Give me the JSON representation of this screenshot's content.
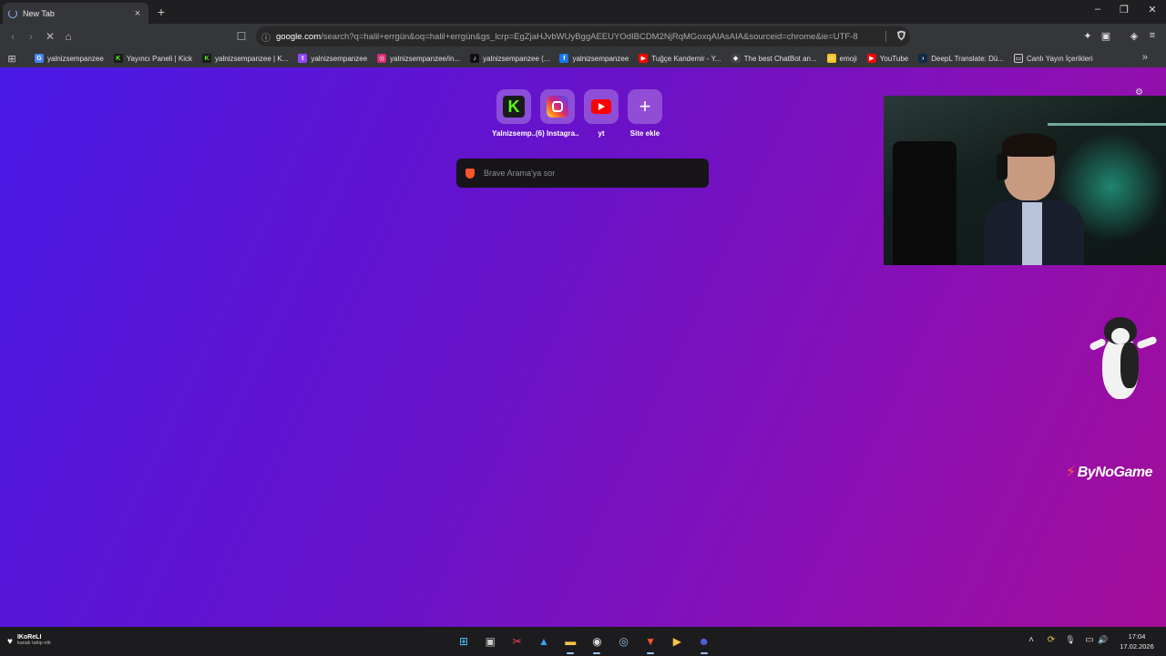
{
  "browser": {
    "tab": {
      "title": "New Tab",
      "close": "×"
    },
    "new_tab": "+",
    "window_controls": {
      "minimize": "–",
      "restore": "❐",
      "close": "✕"
    },
    "nav": {
      "back": "‹",
      "forward": "›",
      "stop": "✕",
      "home": "⌂",
      "bookmark": "☐"
    },
    "address": {
      "host": "google.com",
      "rest": "/search?q=halil+errgün&oq=halil+errgün&gs_lcrp=EgZjaHJvbWUyBggAEEUYOdIBCDM2NjRqMGoxqAIAsAIA&sourceid=chrome&ie=UTF-8",
      "info_icon": "ⓘ",
      "shield_icon": "brave-shield-icon"
    },
    "toolbar_icons": [
      "extensions-icon",
      "sidebar-icon",
      "vpn-icon",
      "menu-icon"
    ]
  },
  "bookmarks": [
    {
      "label": "yalnizsempanzee",
      "icon": "google-icon",
      "color": "#4285f4",
      "glyph": "G"
    },
    {
      "label": "Yayıncı Paneli | Kick",
      "icon": "kick-icon",
      "color": "#53fc18",
      "glyph": "K"
    },
    {
      "label": "yalnizsempanzee | K...",
      "icon": "kick-icon",
      "color": "#53fc18",
      "glyph": "K"
    },
    {
      "label": "yalnizsempanzee",
      "icon": "twitch-icon",
      "color": "#9146ff",
      "glyph": "t"
    },
    {
      "label": "yalnizsempanzee/in...",
      "icon": "instagram-icon",
      "color": "#d62976",
      "glyph": "◎"
    },
    {
      "label": "yalnizsempanzee (...",
      "icon": "tiktok-icon",
      "color": "#111111",
      "glyph": "♪"
    },
    {
      "label": "yalnizsempanzee",
      "icon": "facebook-icon",
      "color": "#1877f2",
      "glyph": "f"
    },
    {
      "label": "Tuğçe Kandemir - Y...",
      "icon": "youtube-icon",
      "color": "#ff0000",
      "glyph": "▶"
    },
    {
      "label": "The best ChatBot an...",
      "icon": "chatbot-icon",
      "color": "#444444",
      "glyph": "◆"
    },
    {
      "label": "emoji",
      "icon": "emoji-icon",
      "color": "#f4c430",
      "glyph": "☺"
    },
    {
      "label": "YouTube",
      "icon": "youtube-icon",
      "color": "#ff0000",
      "glyph": "▶"
    },
    {
      "label": "DeepL Translate: Dü...",
      "icon": "deepl-icon",
      "color": "#0f2b46",
      "glyph": "›"
    },
    {
      "label": "Canlı Yayın İçerikleri",
      "icon": "folder-icon",
      "color": "#35363a",
      "glyph": "▭"
    }
  ],
  "newtab": {
    "shortcuts": [
      {
        "label": "Yalnizsemp...",
        "icon": "kick-icon"
      },
      {
        "label": "(6) Instagra...",
        "icon": "instagram-icon"
      },
      {
        "label": "yt",
        "icon": "youtube-icon"
      },
      {
        "label": "Site ekle",
        "icon": "plus-icon"
      }
    ],
    "search_placeholder": "Brave Arama'ya sor",
    "kick_glyph": "K",
    "plus_glyph": "+",
    "gear": "⚙"
  },
  "overlay": {
    "brand": "ByNoGame",
    "brand_flame": "⚡"
  },
  "taskbar": {
    "notification": {
      "name": "IKoReLI",
      "sub": "kanalı takip etti"
    },
    "apps": [
      {
        "name": "start-icon",
        "glyph": "⊞",
        "color": "#4cc2ff",
        "active": false
      },
      {
        "name": "task-view-icon",
        "glyph": "▣",
        "color": "#cccccc",
        "active": false
      },
      {
        "name": "snipping-tool-icon",
        "glyph": "✂",
        "color": "#e74856",
        "active": false
      },
      {
        "name": "photos-icon",
        "glyph": "▲",
        "color": "#3aa0f0",
        "active": false
      },
      {
        "name": "file-explorer-icon",
        "glyph": "▬",
        "color": "#f6c445",
        "active": true
      },
      {
        "name": "obs-icon",
        "glyph": "◉",
        "color": "#dddddd",
        "active": true
      },
      {
        "name": "steam-icon",
        "glyph": "◎",
        "color": "#8fbfe0",
        "active": false
      },
      {
        "name": "brave-icon",
        "glyph": "▼",
        "color": "#fb542b",
        "active": true
      },
      {
        "name": "media-player-icon",
        "glyph": "▶",
        "color": "#f6c445",
        "active": false
      },
      {
        "name": "discord-icon",
        "glyph": "☻",
        "color": "#5865f2",
        "active": true
      }
    ],
    "tray": {
      "chevron": "˄",
      "sync": "⟳",
      "mic": "🎙",
      "monitor": "▭",
      "volume": "🔊"
    },
    "clock": {
      "time": "17:04",
      "date": "17.02.2026"
    }
  }
}
